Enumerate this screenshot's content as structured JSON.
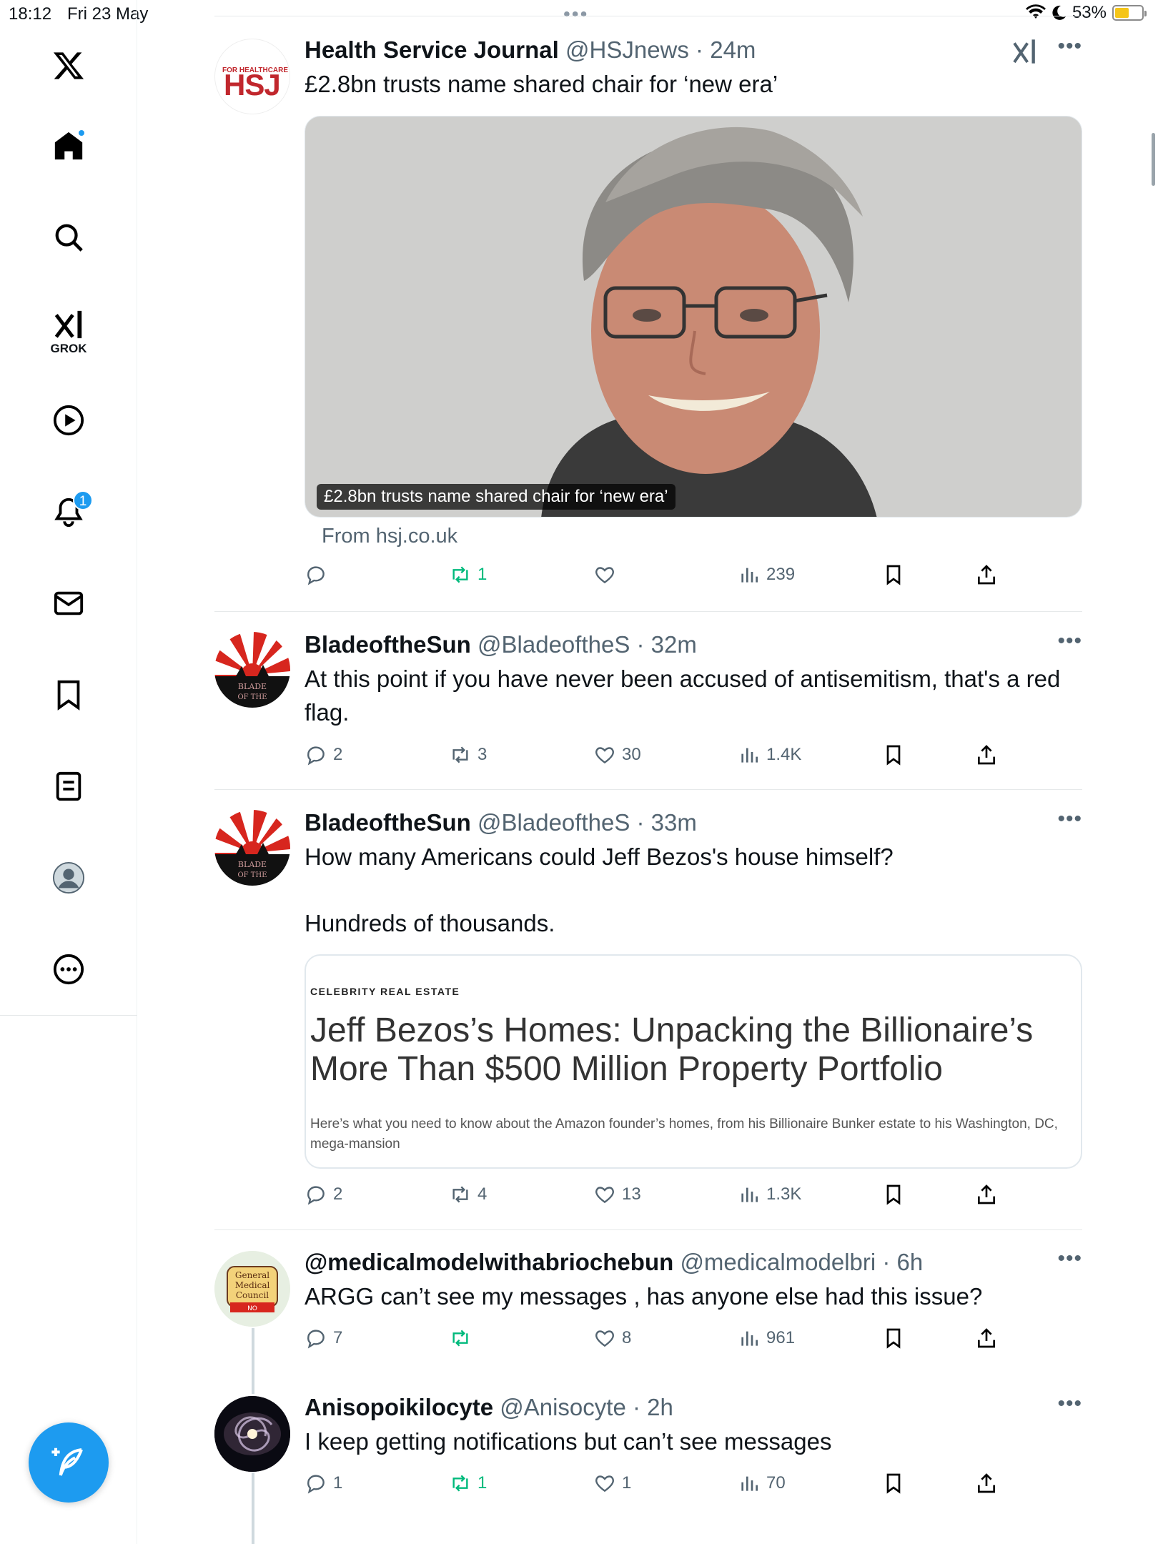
{
  "status_bar": {
    "time": "18:12",
    "date": "Fri 23 May",
    "battery_text": "53%",
    "battery_level": 0.53
  },
  "sidebar": {
    "grok_label": "GROK",
    "notifications_count": "1",
    "items": [
      "home-icon",
      "search-icon",
      "grok-icon",
      "video-icon",
      "notifications-icon",
      "messages-icon",
      "bookmarks-icon",
      "lists-icon",
      "profile-icon",
      "more-icon"
    ]
  },
  "tweets": [
    {
      "name": "Health Service Journal",
      "handle": "@HSJnews",
      "time": "24m",
      "text": "£2.8bn trusts name shared chair for ‘new era’",
      "media_caption": "£2.8bn trusts name shared chair for ‘new era’",
      "from": "From hsj.co.uk",
      "avatar_text": "HSJ",
      "avatar_subtext": "FOR HEALTHCARE LEADERS",
      "replies": "",
      "retweets": "1",
      "likes": "",
      "views": "239"
    },
    {
      "name": "BladeoftheSun",
      "handle": "@BladeoftheS",
      "time": "32m",
      "text": "At this point if you have never been accused of antisemitism, that's a red flag.",
      "replies": "2",
      "retweets": "3",
      "likes": "30",
      "views": "1.4K"
    },
    {
      "name": "BladeoftheSun",
      "handle": "@BladeoftheS",
      "time": "33m",
      "text_line1": "How many Americans could Jeff Bezos's house himself?",
      "text_line2": "Hundreds of thousands.",
      "card": {
        "category": "CELEBRITY REAL ESTATE",
        "title": "Jeff Bezos’s Homes: Unpacking the Billionaire’s More Than $500 Million Property Portfolio",
        "description": "Here’s what you need to know about the Amazon founder’s homes, from his Billionaire Bunker estate to his Washington, DC, mega-mansion"
      },
      "replies": "2",
      "retweets": "4",
      "likes": "13",
      "views": "1.3K"
    },
    {
      "name": "@medicalmodelwithabriochebun",
      "handle": "@medicalmodelbri",
      "time": "6h",
      "text": "ARGG can’t see my messages , has anyone else had this issue?",
      "replies": "7",
      "retweets": "",
      "likes": "8",
      "views": "961"
    },
    {
      "name": "Anisopoikilocyte",
      "handle": "@Anisocyte",
      "time": "2h",
      "text": "I keep getting notifications but can’t see messages",
      "replies": "1",
      "retweets": "1",
      "likes": "1",
      "views": "70"
    }
  ],
  "colors": {
    "accent": "#1d9bf0",
    "retweet_green": "#00ba7c",
    "secondary_text": "#536471"
  }
}
